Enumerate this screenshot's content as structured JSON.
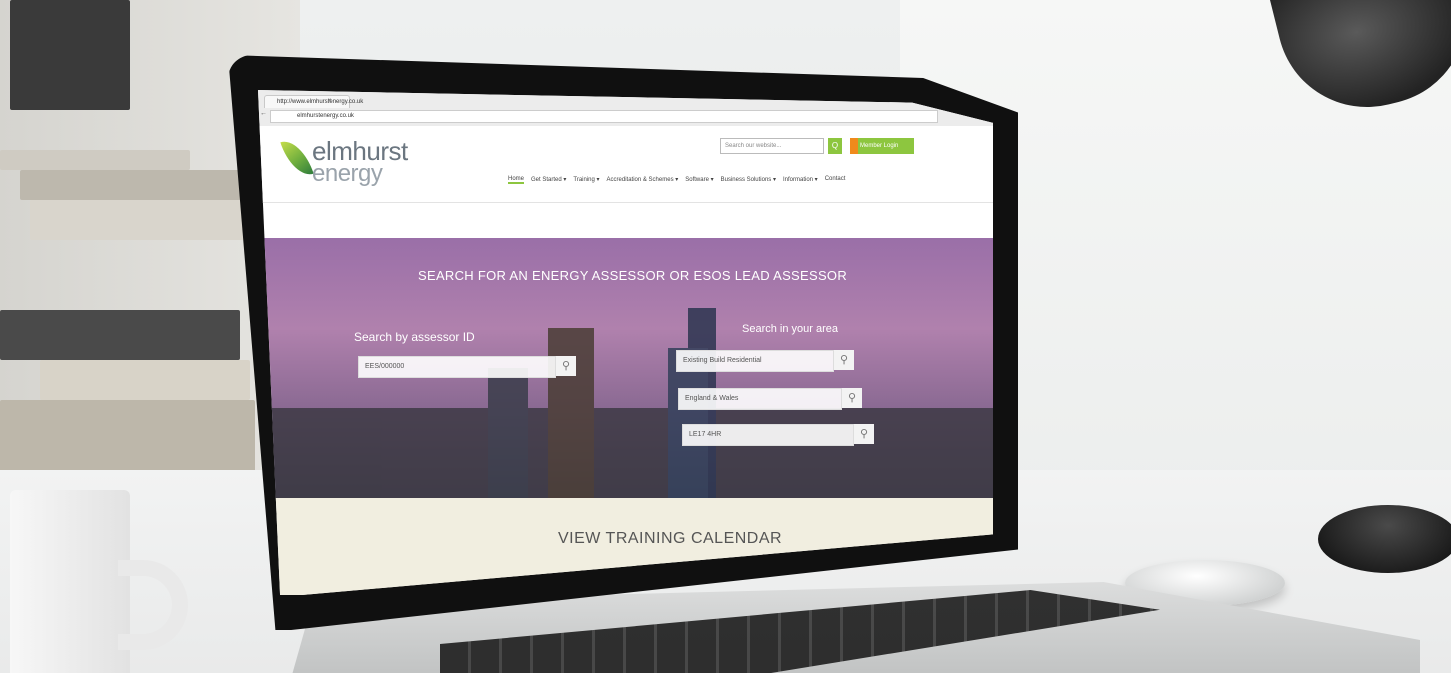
{
  "browser": {
    "tab_title": "http://www.elmhurstenergy.co.uk",
    "tab_close": "×",
    "url": "elmhurstenergy.co.uk",
    "nav_glyphs": "← → C",
    "menu_glyphs": "☆ ≡"
  },
  "header": {
    "logo_line1": "elmhurst",
    "logo_line2": "energy",
    "search_placeholder": "Search our website...",
    "search_button": "Q",
    "member_login": "Member Login",
    "nav": [
      "Home",
      "Get Started ▾",
      "Training ▾",
      "Accreditation & Schemes ▾",
      "Software ▾",
      "Business Solutions ▾",
      "Information ▾",
      "Contact"
    ]
  },
  "hero": {
    "title": "SEARCH FOR AN ENERGY ASSESSOR OR ESOS LEAD ASSESSOR",
    "search_id_label": "Search by assessor ID",
    "assessor_id_value": "EES/000000",
    "search_area_label": "Search in your area",
    "area_fields": [
      "Existing Build Residential",
      "England & Wales",
      "LE17 4HR"
    ],
    "search_icon": "magnifier-icon"
  },
  "calendar": {
    "label": "VIEW TRAINING CALENDAR"
  },
  "colors": {
    "brand_green": "#8dc63f",
    "brand_orange": "#f08a1c",
    "hero_purple": "#b081ad",
    "calendar_bg": "#f1eee0"
  }
}
